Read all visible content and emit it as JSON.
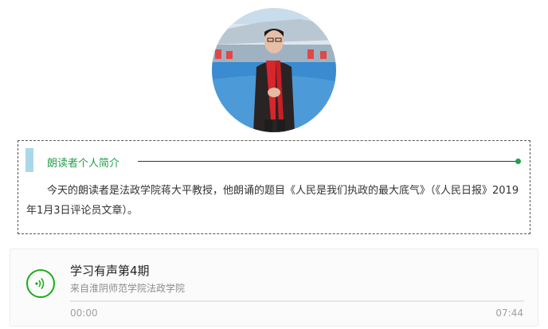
{
  "reader": {
    "photo_icon": "portrait-photo",
    "section_title": "朗读者个人简介",
    "bio": "今天的朗读者是法政学院蒋大平教授，他朗诵的题目《人民是我们执政的最大底气》（《人民日报》2019年1月3日评论员文章）。"
  },
  "audio": {
    "play_icon": "sound-wave-icon",
    "title": "学习有声第4期",
    "source": "来自淮阴师范学院法政学院",
    "current_time": "00:00",
    "duration": "07:44",
    "progress": 0
  },
  "colors": {
    "accent_green": "#21a14a",
    "accent_blue": "#a9d8e8",
    "player_green": "#1aad19"
  }
}
